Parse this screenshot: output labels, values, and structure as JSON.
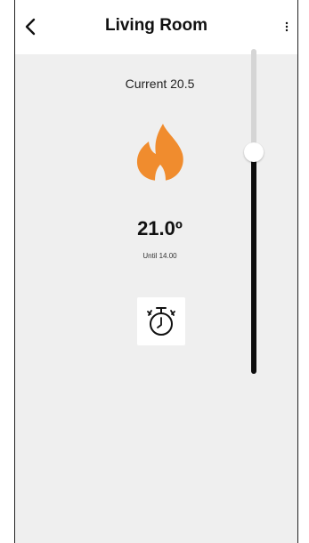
{
  "header": {
    "title": "Living Room",
    "back_icon": "chevron-left-icon",
    "more_icon": "vertical-dots-icon"
  },
  "thermostat": {
    "current_label": "Current 20.5",
    "setpoint_label": "21.0º",
    "until_label": "Until 14.00",
    "mode_icon": "flame-icon",
    "timer_icon": "stopwatch-icon",
    "slider_level_fraction": 0.7
  },
  "colors": {
    "flame": "#f08c2e",
    "background": "#efefef",
    "track_active": "#0d0d0d",
    "track_inactive": "#d5d5d5"
  }
}
